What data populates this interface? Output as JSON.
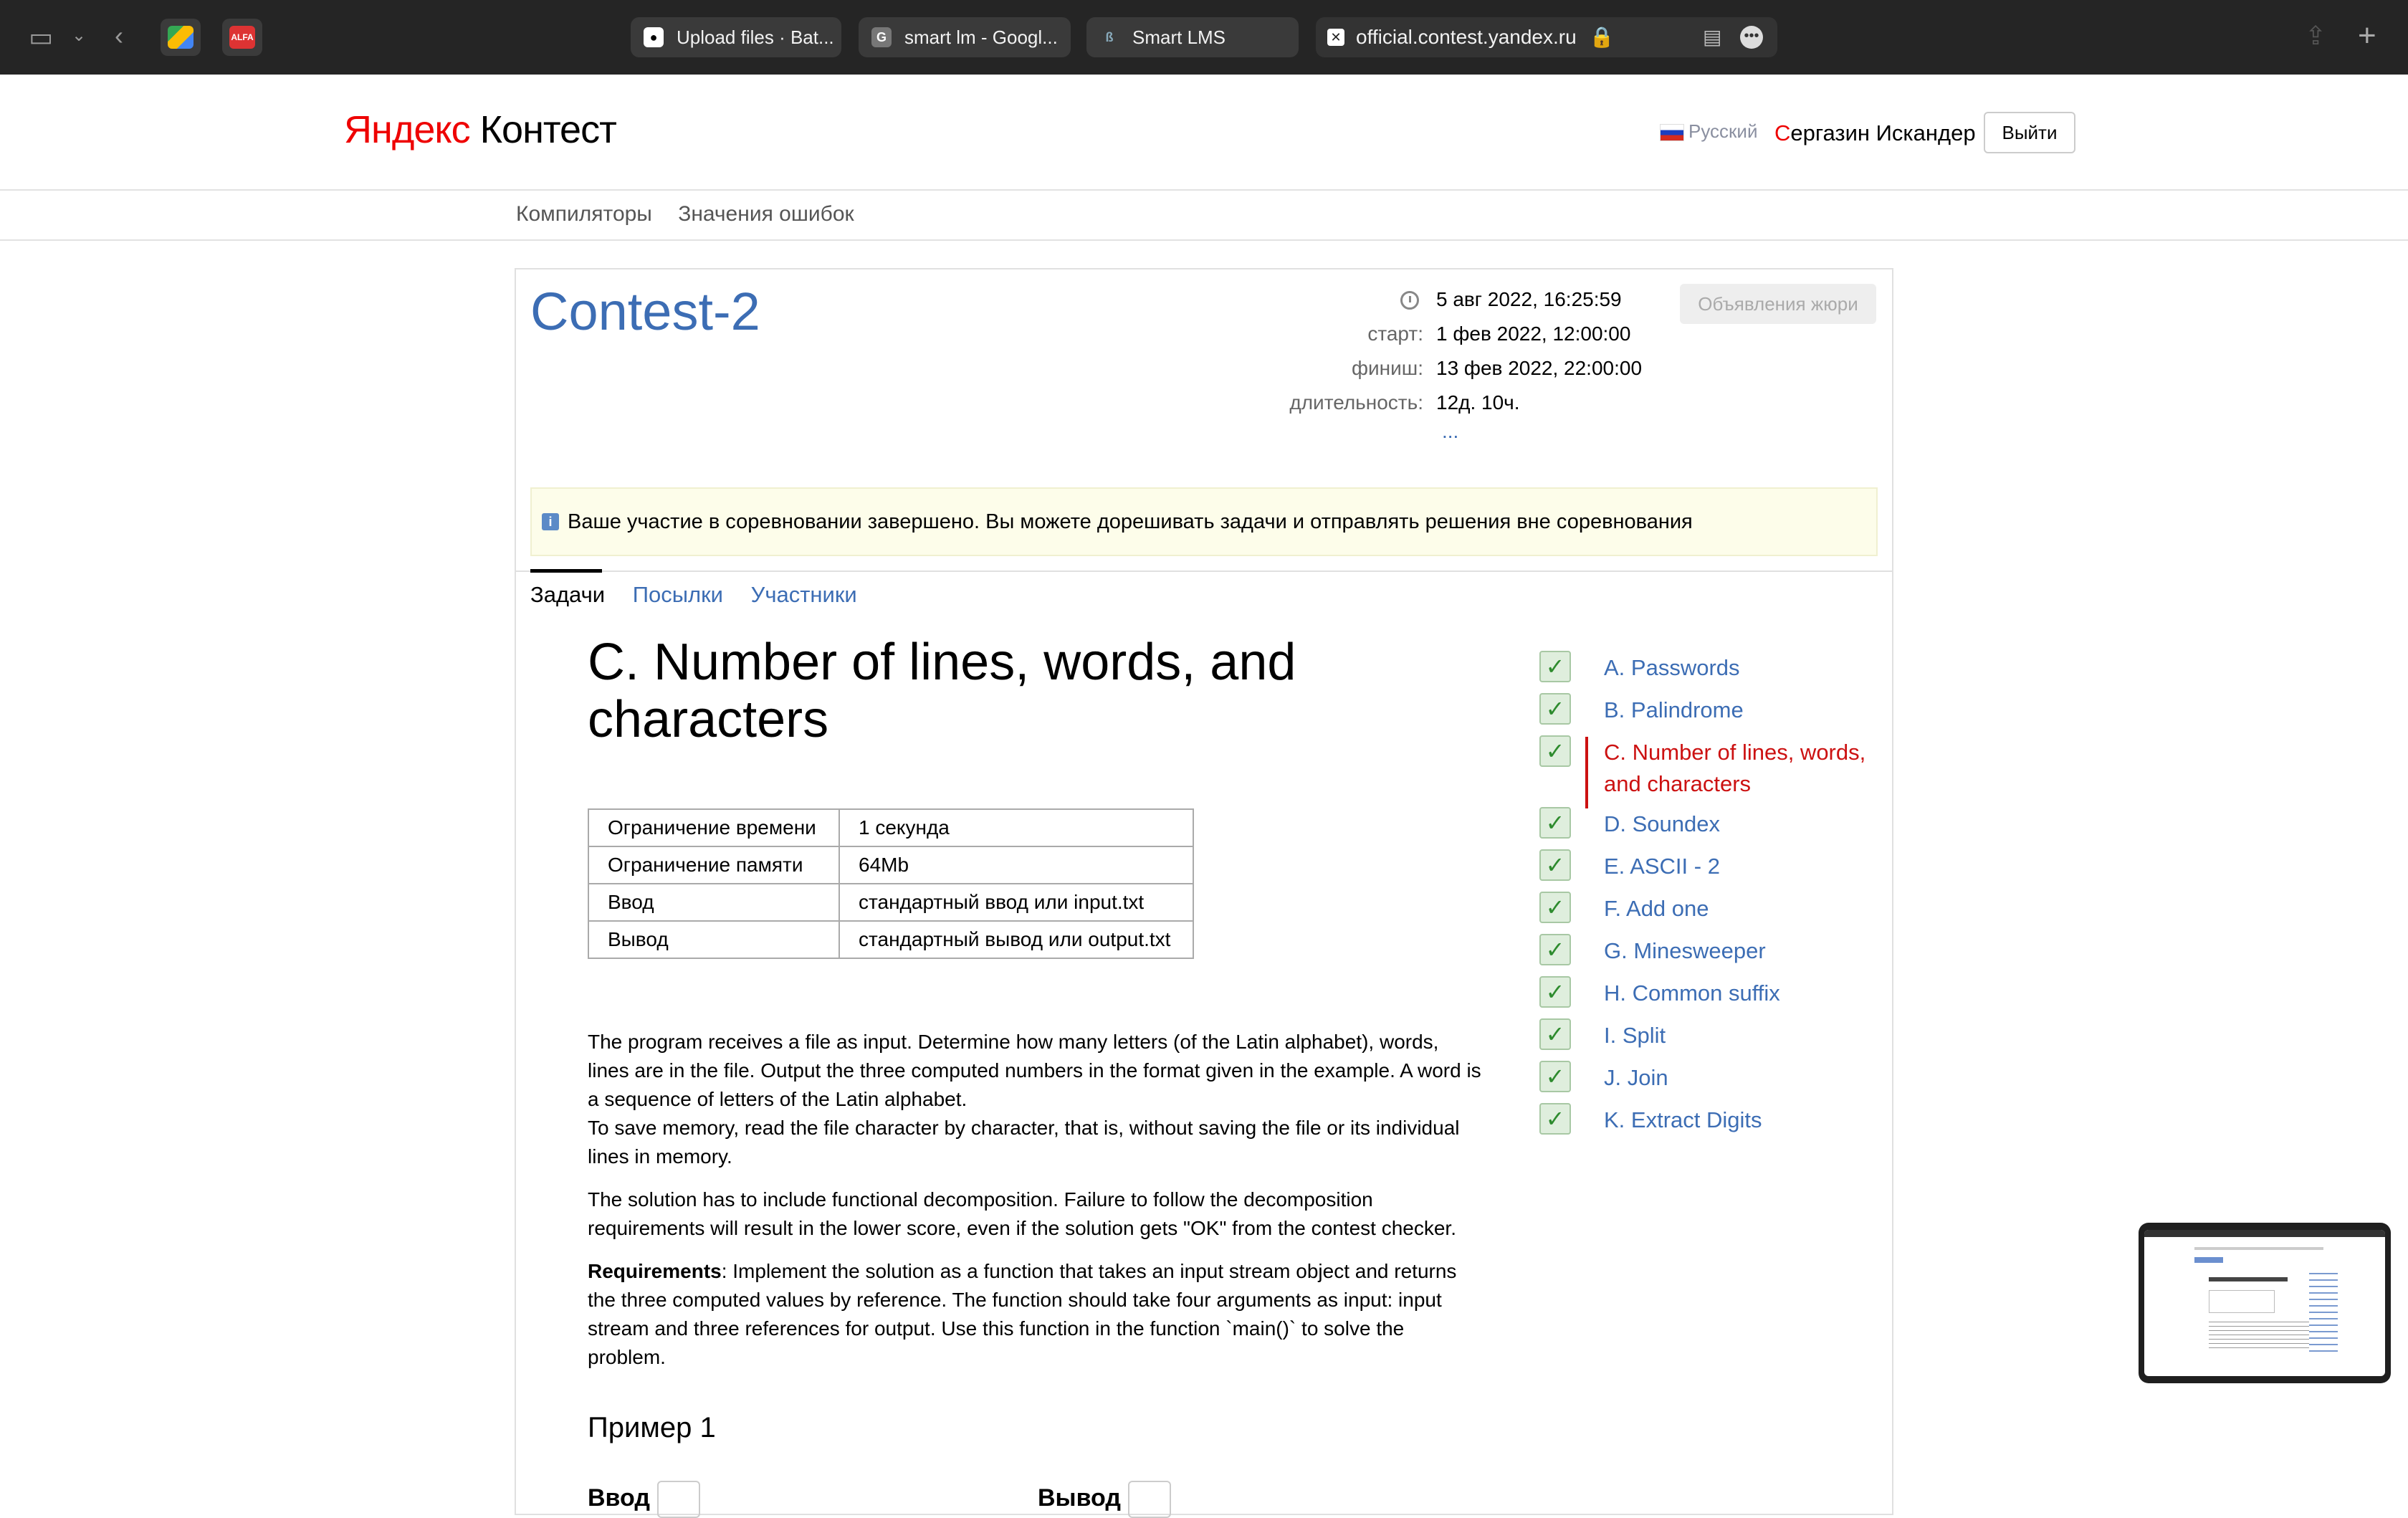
{
  "browser": {
    "tabs": [
      {
        "label": "Upload files · Bat...",
        "icon": "github-icon"
      },
      {
        "label": "smart lm - Googl...",
        "icon": "google-icon"
      },
      {
        "label": "Smart LMS",
        "icon": "lms-icon"
      }
    ],
    "address": "official.contest.yandex.ru"
  },
  "header": {
    "logo_ya": "Яндекс",
    "logo_rest": " Контест",
    "language": "Русский",
    "user_first": "С",
    "user_rest": "ергазин Искандер",
    "logout": "Выйти"
  },
  "subnav": [
    "Компиляторы",
    "Значения ошибок"
  ],
  "contest": {
    "title": "Contest-2",
    "now": "5 авг 2022, 16:25:59",
    "start_label": "старт:",
    "start": "1 фев 2022, 12:00:00",
    "finish_label": "финиш:",
    "finish": "13 фев 2022, 22:00:00",
    "duration_label": "длительность:",
    "duration": "12д. 10ч.",
    "more": "...",
    "jury_button": "Объявления жюри",
    "notice": "Ваше участие в соревновании завершено. Вы можете дорешивать задачи и отправлять решения вне соревнования",
    "tabs": [
      "Задачи",
      "Посылки",
      "Участники"
    ]
  },
  "problem": {
    "title": "C. Number of lines, words, and characters",
    "limits": [
      [
        "Ограничение времени",
        "1 секунда"
      ],
      [
        "Ограничение памяти",
        "64Mb"
      ],
      [
        "Ввод",
        "стандартный ввод или input.txt"
      ],
      [
        "Вывод",
        "стандартный вывод или output.txt"
      ]
    ],
    "p1": "The program receives a file as input. Determine how many letters (of the Latin alphabet), words, lines are in the file. Output the three computed numbers in the format given in the example. A word is a sequence of letters of the Latin alphabet.",
    "p1b": "To save memory, read the file character by character, that is, without saving the file or its individual lines in memory.",
    "p2": "The solution has to include functional decomposition. Failure to follow the decomposition requirements will result in the lower score, even if the solution gets \"OK\" from the contest checker.",
    "req_label": "Requirements",
    "p3": ": Implement the solution as a function that takes an input stream object and returns the three computed values by reference. The function should take four arguments as input: input stream and three references for output. Use this function in the function `main()` to solve the problem.",
    "example_title": "Пример 1",
    "input_label": "Ввод",
    "output_label": "Вывод"
  },
  "problems": [
    {
      "label": "A. Passwords",
      "solved": true
    },
    {
      "label": "B. Palindrome",
      "solved": true
    },
    {
      "label": "C. Number of lines, words, and characters",
      "solved": true,
      "selected": true
    },
    {
      "label": "D. Soundex",
      "solved": true
    },
    {
      "label": "E. ASCII - 2",
      "solved": true
    },
    {
      "label": "F. Add one",
      "solved": true
    },
    {
      "label": "G. Minesweeper",
      "solved": true
    },
    {
      "label": "H. Common suffix",
      "solved": true
    },
    {
      "label": "I. Split",
      "solved": true
    },
    {
      "label": "J. Join",
      "solved": true
    },
    {
      "label": "K. Extract Digits",
      "solved": true
    }
  ],
  "colors": {
    "link": "#3c6db4",
    "selected": "#cc1111",
    "brand_red": "#ee0000"
  }
}
